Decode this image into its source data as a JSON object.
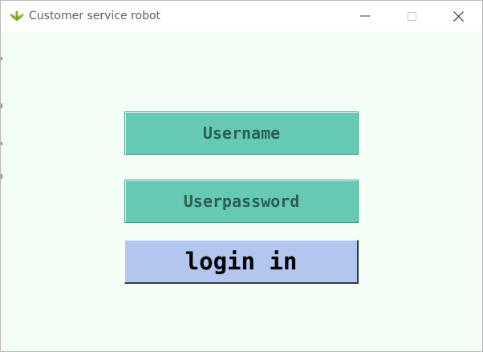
{
  "window": {
    "title": "Customer service robot",
    "app_icon": "leaf-app-icon",
    "controls": {
      "minimize_icon": "minimize-icon",
      "maximize_icon": "maximize-icon",
      "close_icon": "close-icon"
    }
  },
  "form": {
    "username_label": "Username",
    "password_label": "Userpassword",
    "login_label": "login in"
  },
  "colors": {
    "background": "#f3fff6",
    "field_fill": "#66c9b4",
    "field_text": "#2b5f52",
    "button_fill": "#b3c6f0",
    "button_text": "#000000"
  }
}
